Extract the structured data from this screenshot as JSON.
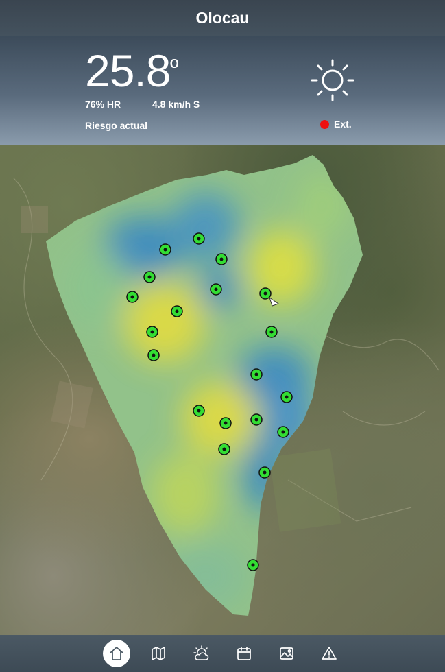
{
  "header": {
    "title": "Olocau"
  },
  "weather": {
    "temperature": "25.8",
    "temperature_unit": "º",
    "humidity": "76% HR",
    "wind": "4.8 km/h S",
    "risk_label": "Riesgo actual",
    "risk_value": "Ext.",
    "risk_color": "#ee1111",
    "condition_icon": "sun-icon"
  },
  "map": {
    "station_color": "#33dd33",
    "stations_count": 22
  },
  "nav": {
    "items": [
      {
        "name": "home",
        "icon": "home-icon",
        "active": true
      },
      {
        "name": "map",
        "icon": "map-icon",
        "active": false
      },
      {
        "name": "forecast",
        "icon": "cloud-sun-icon",
        "active": false
      },
      {
        "name": "calendar",
        "icon": "calendar-icon",
        "active": false
      },
      {
        "name": "gallery",
        "icon": "image-icon",
        "active": false
      },
      {
        "name": "alerts",
        "icon": "warning-icon",
        "active": false
      }
    ]
  }
}
